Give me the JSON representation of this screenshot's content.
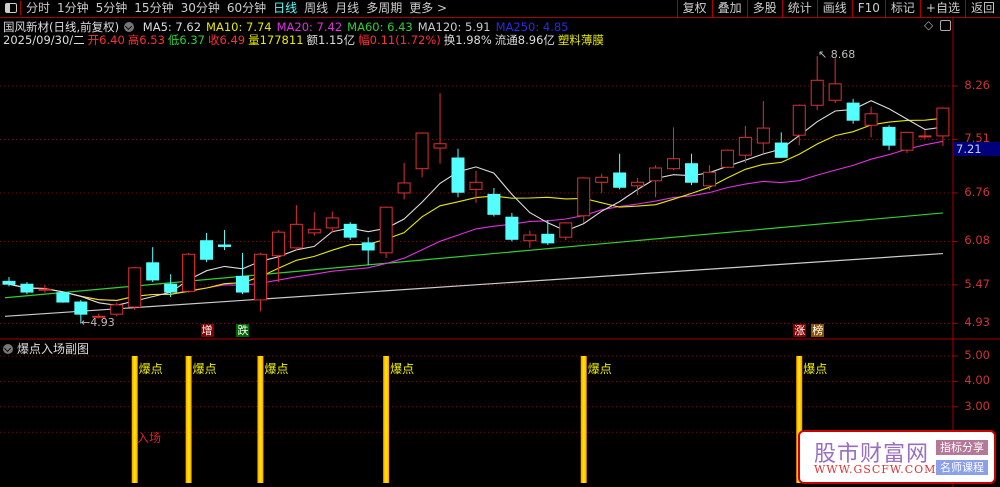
{
  "toolbar": {
    "periods": [
      "分时",
      "1分钟",
      "5分钟",
      "15分钟",
      "30分钟",
      "60分钟",
      "日线",
      "周线",
      "月线",
      "多周期",
      "更多 >"
    ],
    "active_period": "日线",
    "buttons": [
      "复权",
      "叠加",
      "多股",
      "统计",
      "画线",
      "F10",
      "标记",
      "+自选",
      "返回"
    ]
  },
  "stock": {
    "title": "国风新材(日线,前复权)",
    "ma": [
      {
        "label": "MA5: 7.62",
        "color": "#dddddd"
      },
      {
        "label": "MA10: 7.74",
        "color": "#e8e800"
      },
      {
        "label": "MA20: 7.42",
        "color": "#e030e0"
      },
      {
        "label": "MA60: 6.43",
        "color": "#30d030"
      },
      {
        "label": "MA120: 5.91",
        "color": "#cccccc"
      },
      {
        "label": "MA250: 4.85",
        "color": "#2a2ae8"
      }
    ],
    "quote": [
      {
        "label": "2025/09/30/二",
        "color": "#dddddd"
      },
      {
        "label": "开6.40",
        "color": "#ff3030"
      },
      {
        "label": "高6.53",
        "color": "#ff3030"
      },
      {
        "label": "低6.37",
        "color": "#30d030"
      },
      {
        "label": "收6.49",
        "color": "#ff3030"
      },
      {
        "label": "量177811",
        "color": "#e8e800"
      },
      {
        "label": "额1.15亿",
        "color": "#dddddd"
      },
      {
        "label": "幅0.11(1.72%)",
        "color": "#ff3030"
      },
      {
        "label": "换1.98%",
        "color": "#dddddd"
      },
      {
        "label": "流通8.96亿",
        "color": "#dddddd"
      },
      {
        "label": "塑料薄膜",
        "color": "#e8e800"
      }
    ]
  },
  "price_axis": [
    "8.26",
    "7.51",
    "6.76",
    "6.08",
    "5.47",
    "4.93"
  ],
  "current_price": "7.21",
  "low_marker": "4.93",
  "high_marker": "8.68",
  "signal_tags": [
    {
      "text": "增",
      "bg": "#8a0000",
      "index": 11
    },
    {
      "text": "跌",
      "bg": "#006600",
      "index": 13
    },
    {
      "text": "涨",
      "bg": "#8a0000",
      "index": 44
    },
    {
      "text": "榜",
      "bg": "#8a5000",
      "index": 45
    }
  ],
  "sub_chart": {
    "title": "爆点入场副图",
    "axis": [
      "5.00",
      "4.00",
      "3.00"
    ],
    "bar_label": "爆点",
    "entry_label": "入场",
    "bar_indices": [
      7,
      10,
      14,
      21,
      32,
      44
    ],
    "bar_value": 5
  },
  "watermark": {
    "name": "股市财富网",
    "url": "WWW.GSCFW.COM",
    "tag1": "指标分享",
    "tag2": "名师课程"
  },
  "chart_data": {
    "type": "candlestick",
    "ylim": [
      4.85,
      8.75
    ],
    "ohlc": [
      [
        5.52,
        5.48,
        5.58,
        5.45
      ],
      [
        5.48,
        5.37,
        5.51,
        5.34
      ],
      [
        5.4,
        5.41,
        5.47,
        5.36
      ],
      [
        5.36,
        5.23,
        5.38,
        5.22
      ],
      [
        5.23,
        5.06,
        5.26,
        4.93
      ],
      [
        5.02,
        5.03,
        5.07,
        5.0
      ],
      [
        5.06,
        5.19,
        5.22,
        5.03
      ],
      [
        5.16,
        5.71,
        5.72,
        5.12
      ],
      [
        5.78,
        5.54,
        6.0,
        5.51
      ],
      [
        5.48,
        5.37,
        5.62,
        5.3
      ],
      [
        5.38,
        5.9,
        5.92,
        5.36
      ],
      [
        6.09,
        5.83,
        6.2,
        5.79
      ],
      [
        6.03,
        6.01,
        6.24,
        5.96
      ],
      [
        5.59,
        5.37,
        5.92,
        5.34
      ],
      [
        5.26,
        5.9,
        5.92,
        5.1
      ],
      [
        5.88,
        6.21,
        6.24,
        5.51
      ],
      [
        5.99,
        6.32,
        6.59,
        5.96
      ],
      [
        6.2,
        6.25,
        6.49,
        6.16
      ],
      [
        6.27,
        6.41,
        6.5,
        6.2
      ],
      [
        6.32,
        6.14,
        6.35,
        6.1
      ],
      [
        6.06,
        5.96,
        6.14,
        5.75
      ],
      [
        5.92,
        6.56,
        6.57,
        5.85
      ],
      [
        6.76,
        6.9,
        7.18,
        6.67
      ],
      [
        7.1,
        7.6,
        7.61,
        6.98
      ],
      [
        7.39,
        7.45,
        8.16,
        7.17
      ],
      [
        7.25,
        6.77,
        7.38,
        6.7
      ],
      [
        6.81,
        6.91,
        7.07,
        6.62
      ],
      [
        6.74,
        6.46,
        6.83,
        6.43
      ],
      [
        6.42,
        6.11,
        6.48,
        6.08
      ],
      [
        6.09,
        6.17,
        6.23,
        5.99
      ],
      [
        6.18,
        6.06,
        6.38,
        6.03
      ],
      [
        6.14,
        6.34,
        6.35,
        6.1
      ],
      [
        6.44,
        6.97,
        6.98,
        6.34
      ],
      [
        6.91,
        6.98,
        7.03,
        6.76
      ],
      [
        7.04,
        6.84,
        7.31,
        6.81
      ],
      [
        6.86,
        6.91,
        6.97,
        6.73
      ],
      [
        6.93,
        7.11,
        7.15,
        6.7
      ],
      [
        7.1,
        7.24,
        7.68,
        7.08
      ],
      [
        7.17,
        6.91,
        7.31,
        6.87
      ],
      [
        6.86,
        7.05,
        7.15,
        6.8
      ],
      [
        7.12,
        7.36,
        7.37,
        7.11
      ],
      [
        7.29,
        7.54,
        7.7,
        7.18
      ],
      [
        7.46,
        7.67,
        8.05,
        7.32
      ],
      [
        7.46,
        7.26,
        7.61,
        7.25
      ],
      [
        7.57,
        7.99,
        8.0,
        7.43
      ],
      [
        7.99,
        8.34,
        8.68,
        7.92
      ],
      [
        8.06,
        8.29,
        8.65,
        8.02
      ],
      [
        8.02,
        7.78,
        8.08,
        7.73
      ],
      [
        7.71,
        7.87,
        7.97,
        7.54
      ],
      [
        7.68,
        7.43,
        7.71,
        7.36
      ],
      [
        7.36,
        7.61,
        7.62,
        7.32
      ],
      [
        7.55,
        7.56,
        7.64,
        7.52
      ],
      [
        7.56,
        7.95,
        7.96,
        7.42
      ]
    ],
    "ma60_range": [
      5.29,
      6.48
    ],
    "ma120_range": [
      5.03,
      5.91
    ],
    "colors": {
      "up": "#e03030",
      "down": "#54ffff",
      "ma5": "#dddddd",
      "ma10": "#e8e800",
      "ma20": "#e030e0",
      "ma60": "#30d030",
      "ma120": "#cccccc"
    }
  }
}
